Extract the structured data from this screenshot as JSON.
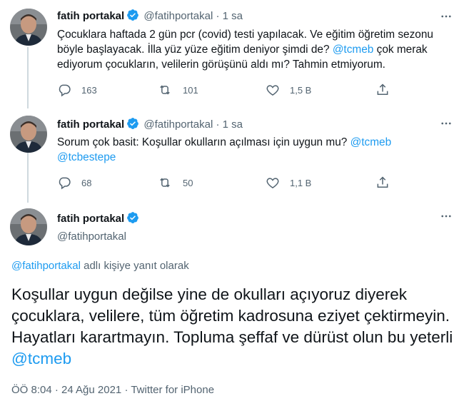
{
  "tweets": [
    {
      "name": "fatih portakal",
      "handle": "@fatihportakal",
      "dot": "·",
      "time": "1 sa",
      "text_parts": [
        "Çocuklara haftada 2 gün pcr (covid) testi yapılacak. Ve eğitim öğretim sezonu böyle başlayacak. İlla yüz yüze eğitim deniyor şimdi de? ",
        "@tcmeb",
        " çok merak ediyorum çocukların, velilerin görüşünü aldı mı? Tahmin etmiyorum."
      ],
      "replies": "163",
      "retweets": "101",
      "likes": "1,5 B"
    },
    {
      "name": "fatih portakal",
      "handle": "@fatihportakal",
      "dot": "·",
      "time": "1 sa",
      "text_parts": [
        "Sorum çok basit: Koşullar okulların açılması için uygun mu? ",
        "@tcmeb",
        "\n",
        "@tcbestepe"
      ],
      "replies": "68",
      "retweets": "50",
      "likes": "1,1 B"
    }
  ],
  "main_tweet": {
    "name": "fatih portakal",
    "handle": "@fatihportakal",
    "reply_to_handle": "@fatihportakal",
    "reply_to_suffix": " adlı kişiye yanıt olarak",
    "text": "Koşullar uygun değilse yine de okulları açıyoruz diyerek çocuklara, velilere, tüm öğretim kadrosuna eziyet çektirmeyin. Hayatları karartmayın. Topluma şeffaf ve dürüst olun bu yeterli ",
    "mention": "@tcmeb",
    "meta": "ÖÖ 8:04 · 24 Ağu 2021 · Twitter for iPhone"
  },
  "colors": {
    "accent": "#1d9bf0",
    "secondary_text": "#536471",
    "primary_text": "#0f1419",
    "thread_line": "#cfd9de"
  },
  "icons": [
    "verified-badge-icon",
    "more-icon",
    "reply-icon",
    "retweet-icon",
    "like-icon",
    "share-icon"
  ]
}
